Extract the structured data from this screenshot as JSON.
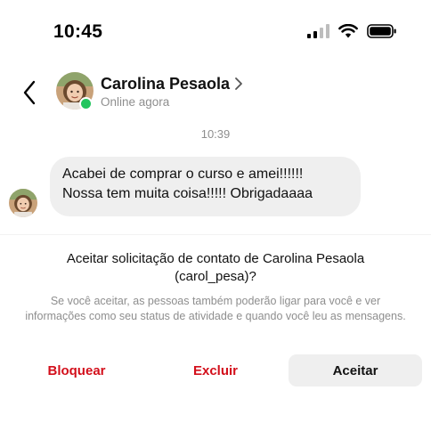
{
  "status_bar": {
    "time": "10:45",
    "icons": [
      "cellular-signal-icon",
      "wifi-icon",
      "battery-icon"
    ]
  },
  "header": {
    "back_icon": "chevron-left-icon",
    "contact_name": "Carolina Pesaola",
    "name_chevron_icon": "chevron-right-icon",
    "status": "Online agora",
    "online_color": "#22c55e"
  },
  "conversation": {
    "timestamp": "10:39",
    "message": {
      "line1": "Acabei de comprar o curso e amei!!!!!!",
      "line2": "Nossa tem muita coisa!!!!! Obrigadaaaa"
    }
  },
  "request": {
    "title": "Aceitar solicitação de contato de Carolina Pesaola (carol_pesa)?",
    "description": "Se você aceitar, as pessoas também poderão ligar para você e ver informações como seu status de atividade e quando você leu as mensagens."
  },
  "actions": {
    "block": "Bloquear",
    "delete": "Excluir",
    "accept": "Aceitar",
    "danger_color": "#d30f1b"
  }
}
